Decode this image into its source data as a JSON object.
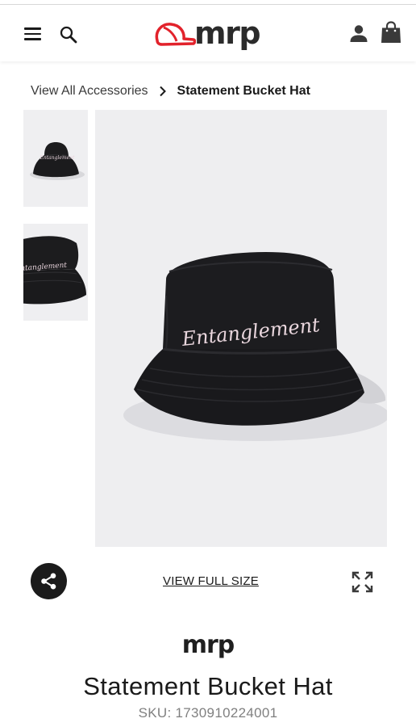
{
  "header": {
    "menu_icon": "hamburger-icon",
    "search_icon": "search-icon",
    "logo_text": "mrp",
    "account_icon": "person-icon",
    "bag_icon": "shopping-bag-icon",
    "accent_color": "#e2222b"
  },
  "breadcrumb": {
    "parent_label": "View All Accessories",
    "current_label": "Statement Bucket Hat"
  },
  "gallery": {
    "hat_text": "Entanglement",
    "view_full_label": "VIEW FULL SIZE",
    "share_icon": "share-icon",
    "expand_icon": "expand-icon"
  },
  "product": {
    "brand": "mrp",
    "title": "Statement Bucket Hat",
    "sku": "SKU: 1730910224001"
  }
}
